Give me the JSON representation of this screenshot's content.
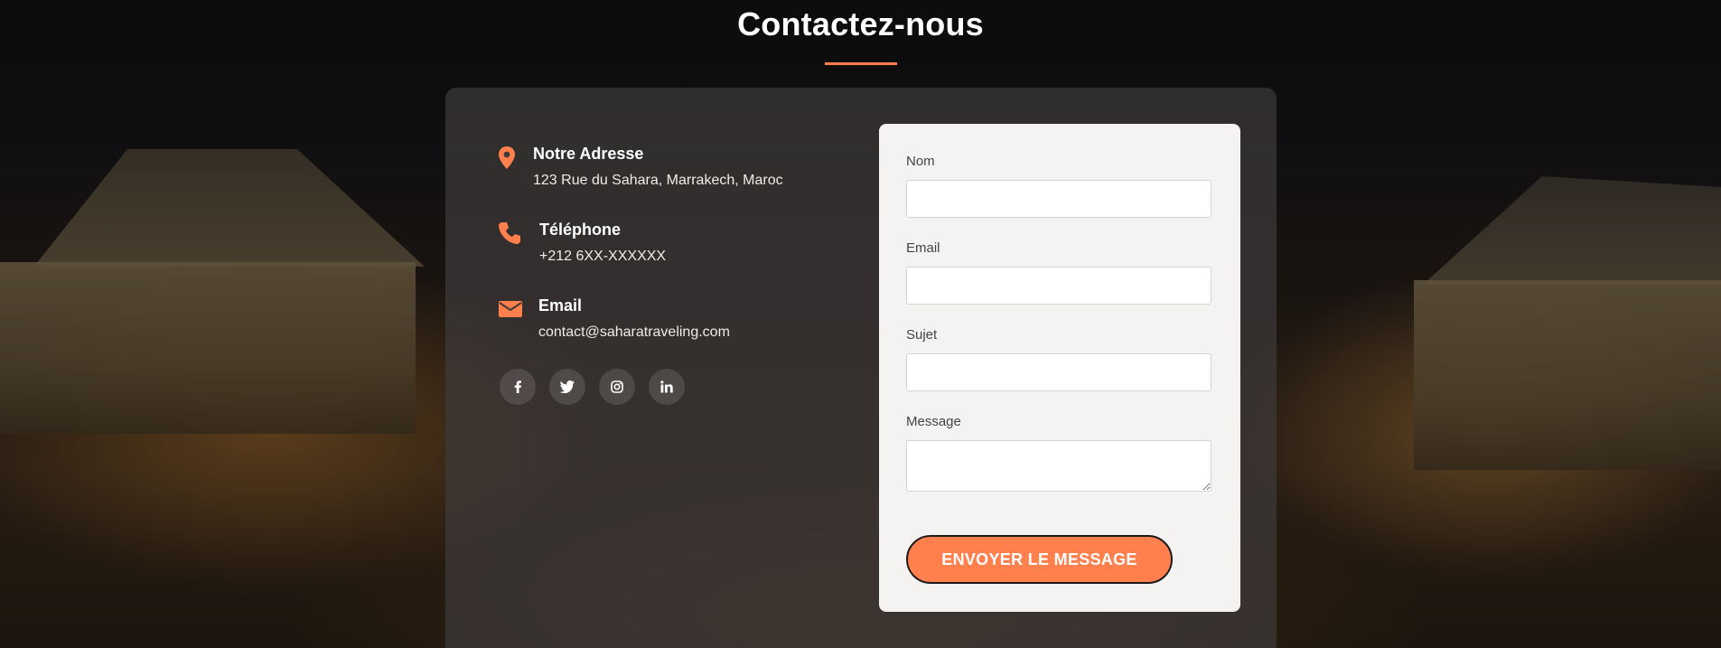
{
  "section": {
    "title": "Contactez-nous"
  },
  "contact": {
    "address": {
      "title": "Notre Adresse",
      "text": "123 Rue du Sahara, Marrakech, Maroc",
      "icon": "map-marker-icon"
    },
    "phone": {
      "title": "Téléphone",
      "text": "+212 6XX-XXXXXX",
      "icon": "phone-icon"
    },
    "email": {
      "title": "Email",
      "text": "contact@saharatraveling.com",
      "icon": "envelope-icon"
    },
    "socials": [
      {
        "name": "facebook",
        "glyph": "f"
      },
      {
        "name": "twitter",
        "glyph": "🐦"
      },
      {
        "name": "instagram",
        "glyph": "◎"
      },
      {
        "name": "linkedin",
        "glyph": "in"
      }
    ]
  },
  "form": {
    "name_label": "Nom",
    "email_label": "Email",
    "subject_label": "Sujet",
    "message_label": "Message",
    "submit_label": "ENVOYER LE MESSAGE"
  },
  "colors": {
    "accent": "#ff7f4d",
    "card": "#3e3a3a",
    "form_bg": "#f4f3f2"
  }
}
